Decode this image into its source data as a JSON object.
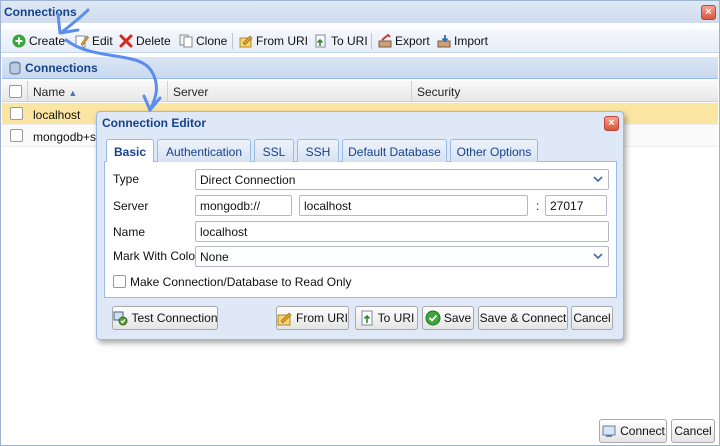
{
  "window": {
    "title": "Connections",
    "close_glyph": "×"
  },
  "toolbar": {
    "create": {
      "label": "Create",
      "icon": "plus-circle-icon"
    },
    "edit": {
      "label": "Edit",
      "icon": "edit-icon"
    },
    "delete": {
      "label": "Delete",
      "icon": "delete-x-icon"
    },
    "clone": {
      "label": "Clone",
      "icon": "clone-icon"
    },
    "from_uri": {
      "label": "From URI",
      "icon": "from-uri-icon"
    },
    "to_uri": {
      "label": "To URI",
      "icon": "to-uri-icon"
    },
    "export": {
      "label": "Export",
      "icon": "export-icon"
    },
    "import": {
      "label": "Import",
      "icon": "import-icon"
    }
  },
  "panel": {
    "title": "Connections"
  },
  "grid": {
    "columns": {
      "name": "Name",
      "server": "Server",
      "security": "Security"
    },
    "rows": [
      {
        "name": "localhost",
        "selected": true
      },
      {
        "name": "mongodb+srv",
        "selected": false
      }
    ]
  },
  "dialog": {
    "title": "Connection Editor",
    "close_glyph": "×",
    "tabs": [
      "Basic",
      "Authentication",
      "SSL",
      "SSH",
      "Default Database",
      "Other Options"
    ],
    "active_tab": "Basic",
    "form": {
      "type_label": "Type",
      "type_value": "Direct Connection",
      "server_label": "Server",
      "server_scheme": "mongodb://",
      "server_host": "localhost",
      "port_sep": ":",
      "server_port": "27017",
      "name_label": "Name",
      "name_value": "localhost",
      "color_label": "Mark With Color",
      "color_value": "None",
      "readonly_label": "Make Connection/Database to Read Only",
      "readonly_checked": false
    },
    "buttons": {
      "test": "Test Connection",
      "from_uri": "From URI",
      "to_uri": "To URI",
      "save": "Save",
      "save_connect": "Save & Connect",
      "cancel": "Cancel"
    }
  },
  "footer": {
    "connect": "Connect",
    "cancel": "Cancel"
  },
  "colors": {
    "accent": "#15428b",
    "selected_row": "#fbe5a3",
    "annotation": "#5b8df0"
  }
}
